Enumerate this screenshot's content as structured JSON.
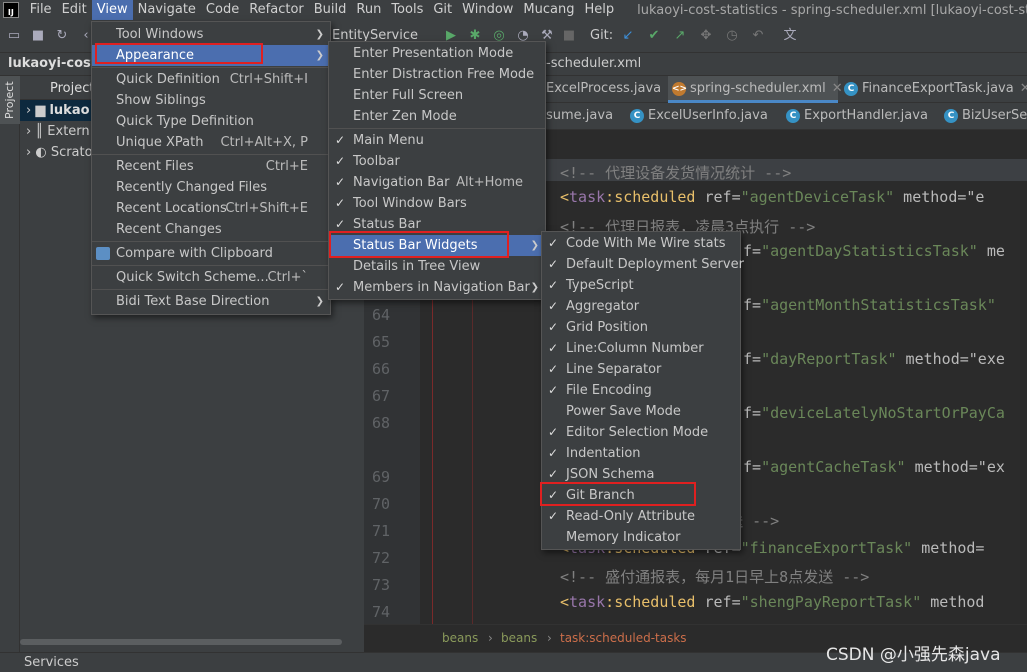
{
  "menubar": {
    "logo": "IJ",
    "items": [
      "File",
      "Edit",
      "View",
      "Navigate",
      "Code",
      "Refactor",
      "Build",
      "Run",
      "Tools",
      "Git",
      "Window",
      "Mucang",
      "Help"
    ],
    "active": "View",
    "window_title": "lukaoyi-cost-statistics - spring-scheduler.xml [lukaoyi-cost-statistics-b"
  },
  "toolbar": {
    "run_config": "EntityService",
    "git_label": "Git:"
  },
  "navbar": {
    "project": "lukaoyi-cost-s",
    "file": "-scheduler.xml"
  },
  "left_tool": {
    "project_tab": "Project"
  },
  "project_panel": {
    "header": "Project",
    "rows": [
      "lukao",
      "Extern",
      "Scrato"
    ]
  },
  "bottom": {
    "services": "Services"
  },
  "editor": {
    "tabs_row1": [
      {
        "label": "ExcelProcess.java"
      },
      {
        "label": "spring-scheduler.xml",
        "active": true
      },
      {
        "label": "FinanceExportTask.java"
      }
    ],
    "tabs_row2": [
      {
        "label": "sume.java"
      },
      {
        "label": "ExcelUserInfo.java"
      },
      {
        "label": "ExportHandler.java"
      },
      {
        "label": "BizUserServ"
      }
    ],
    "line_numbers": [
      "64",
      "65",
      "66",
      "67",
      "68",
      "69",
      "70",
      "71",
      "72",
      "73",
      "74"
    ],
    "code": [
      {
        "k": "c",
        "t": "<!-- 代理设备发货情况统计 -->"
      },
      {
        "k": "t",
        "tag": "task",
        "name": "scheduled",
        "attr": "ref",
        "val": "\"agentDeviceTask\"",
        "tail": " method=\"e"
      },
      {
        "k": "c",
        "t": "<!-- 代理日报表，凌晨3点执行 -->"
      },
      {
        "k": "f",
        "pre": "f=",
        "val": "\"agentDayStatisticsTask\"",
        "tail": " me"
      },
      {
        "k": "c",
        "t": "3点执行 -->"
      },
      {
        "k": "f",
        "pre": "f=",
        "val": "\"agentMonthStatisticsTask\"",
        "tail": ""
      },
      {
        "k": "c",
        "t": "每天7点发送 -->"
      },
      {
        "k": "f",
        "pre": "f=",
        "val": "\"dayReportTask\"",
        "tail": " method=\"exe"
      },
      {
        "k": "f",
        "pre": "f=",
        "val": "\"deviceLatelyNoStartOrPayCa",
        "tail": ""
      },
      {
        "k": "f",
        "pre": "f=",
        "val": "\"agentCacheTask\"",
        "tail": " method=\"ex"
      },
      {
        "k": "c",
        "t": "报表，每月1日早上8点发送 -->"
      },
      {
        "k": "t",
        "tag": "task",
        "name": "scheduled",
        "attr": "ref",
        "val": "\"financeExportTask\"",
        "tail": " method="
      },
      {
        "k": "c",
        "t": "<!-- 盛付通报表，每月1日早上8点发送 -->"
      },
      {
        "k": "t",
        "tag": "task",
        "name": "scheduled",
        "attr": "ref",
        "val": "\"shengPayReportTask\"",
        "tail": " method"
      }
    ],
    "breadcrumbs": [
      "beans",
      "beans",
      "task:scheduled-tasks"
    ]
  },
  "view_menu": [
    {
      "label": "Tool Windows",
      "arrow": true
    },
    {
      "label": "Appearance",
      "arrow": true,
      "hl": true
    },
    {
      "sep": true
    },
    {
      "label": "Quick Definition",
      "sc": "Ctrl+Shift+I"
    },
    {
      "label": "Show Siblings"
    },
    {
      "label": "Quick Type Definition"
    },
    {
      "label": "Unique XPath",
      "sc": "Ctrl+Alt+X, P"
    },
    {
      "sep": true
    },
    {
      "label": "Recent Files",
      "sc": "Ctrl+E"
    },
    {
      "label": "Recently Changed Files"
    },
    {
      "label": "Recent Locations",
      "sc": "Ctrl+Shift+E"
    },
    {
      "label": "Recent Changes"
    },
    {
      "sep": true
    },
    {
      "label": "Compare with Clipboard",
      "icon": true
    },
    {
      "sep": true
    },
    {
      "label": "Quick Switch Scheme...",
      "sc": "Ctrl+`"
    },
    {
      "sep": true
    },
    {
      "label": "Bidi Text Base Direction",
      "arrow": true
    }
  ],
  "appearance_menu": [
    {
      "label": "Enter Presentation Mode"
    },
    {
      "label": "Enter Distraction Free Mode"
    },
    {
      "label": "Enter Full Screen"
    },
    {
      "label": "Enter Zen Mode"
    },
    {
      "sep": true
    },
    {
      "label": "Main Menu",
      "chk": true
    },
    {
      "label": "Toolbar",
      "chk": true
    },
    {
      "label": "Navigation Bar",
      "chk": true,
      "sc": "Alt+Home"
    },
    {
      "label": "Tool Window Bars",
      "chk": true
    },
    {
      "label": "Status Bar",
      "chk": true
    },
    {
      "label": "Status Bar Widgets",
      "arrow": true,
      "hl": true
    },
    {
      "label": "Details in Tree View"
    },
    {
      "label": "Members in Navigation Bar",
      "chk": true,
      "arrow": true
    }
  ],
  "widgets_menu": [
    {
      "label": "Code With Me Wire stats",
      "chk": true
    },
    {
      "label": "Default Deployment Server",
      "chk": true
    },
    {
      "label": "TypeScript",
      "chk": true
    },
    {
      "label": "Aggregator",
      "chk": true
    },
    {
      "label": "Grid Position",
      "chk": true
    },
    {
      "label": "Line:Column Number",
      "chk": true
    },
    {
      "label": "Line Separator",
      "chk": true
    },
    {
      "label": "File Encoding",
      "chk": true
    },
    {
      "label": "Power Save Mode"
    },
    {
      "label": "Editor Selection Mode",
      "chk": true
    },
    {
      "label": "Indentation",
      "chk": true
    },
    {
      "label": "JSON Schema",
      "chk": true
    },
    {
      "label": "Git Branch",
      "chk": true
    },
    {
      "label": "Read-Only Attribute",
      "chk": true
    },
    {
      "label": "Memory Indicator"
    }
  ],
  "watermark": "CSDN @小强先森java"
}
